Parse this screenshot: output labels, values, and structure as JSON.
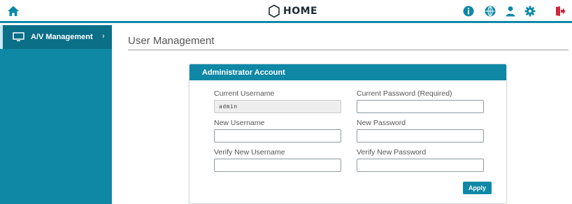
{
  "brand": {
    "name": "HOME"
  },
  "topbar": {
    "icons": [
      "home-icon",
      "info-icon",
      "globe-icon",
      "user-icon",
      "gear-icon",
      "logout-icon"
    ],
    "accent_color": "#0f88a6",
    "logout_color": "#d0263f"
  },
  "sidebar": {
    "items": [
      {
        "label": "A/V Management",
        "icon": "monitor-icon",
        "chevron": "›"
      }
    ]
  },
  "main": {
    "title": "User Management",
    "panel": {
      "header": "Administrator Account",
      "fields": {
        "current_username": {
          "label": "Current Username",
          "value": "admin"
        },
        "current_password": {
          "label": "Current Password (Required)",
          "value": ""
        },
        "new_username": {
          "label": "New Username",
          "value": ""
        },
        "new_password": {
          "label": "New Password",
          "value": ""
        },
        "verify_username": {
          "label": "Verify New Username",
          "value": ""
        },
        "verify_password": {
          "label": "Verify New Password",
          "value": ""
        }
      },
      "apply_label": "Apply"
    }
  }
}
